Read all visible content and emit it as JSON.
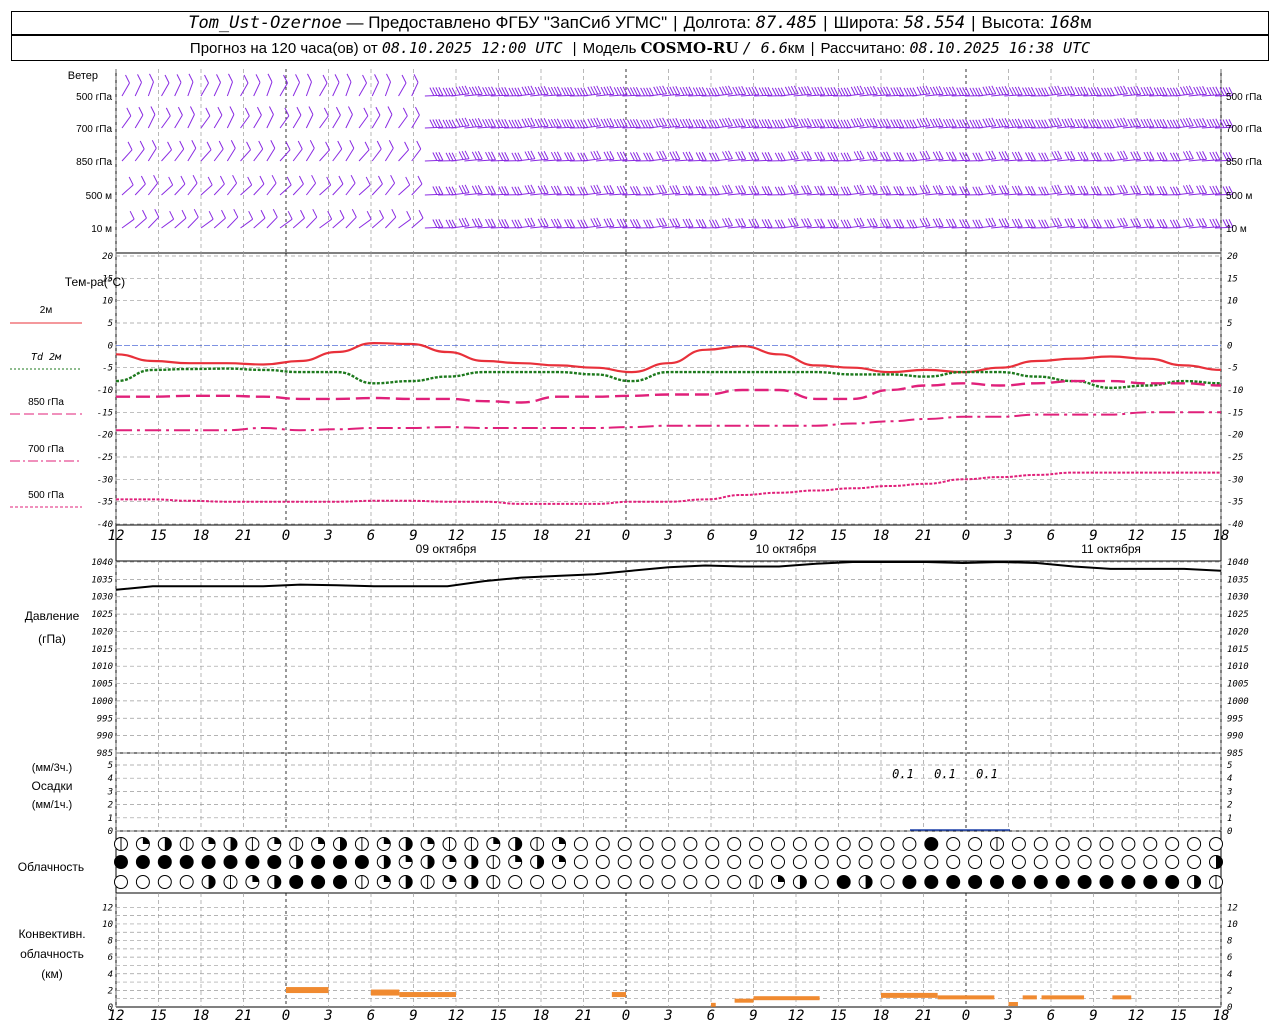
{
  "header": {
    "station": "Tom_Ust-Ozernoe",
    "provider": "— Предоставлено ФГБУ \"ЗапСиб УГМС\"",
    "lon_label": "Долгота:",
    "lon_value": "87.485",
    "lat_label": "Широта:",
    "lat_value": "58.554",
    "alt_label": "Высота:",
    "alt_value": "168",
    "alt_unit": "м",
    "forecast_prefix": "Прогноз на 120 часа(ов) от",
    "forecast_time": "08.10.2025 12:00 UTC",
    "model_label": "Модель",
    "model_name": "COSMO-RU",
    "model_res": "/ 6.6",
    "model_res_unit": "км",
    "calc_label": "Рассчитано:",
    "calc_time": "08.10.2025 16:38 UTC"
  },
  "colors": {
    "wind": "#8a2be2",
    "t2m": "#e8303a",
    "td2m": "#1e7a1e",
    "t850": "#e0207a",
    "t700": "#e0207a",
    "t500": "#e0207a",
    "pressure": "#000000",
    "precip": "#1a3fa8",
    "convective": "#f08a30",
    "grid": "#9a9a9a",
    "zero_line": "#3050d0"
  },
  "time_axis": {
    "hour_labels": [
      "12",
      "15",
      "18",
      "21",
      "0",
      "3",
      "6",
      "9",
      "12",
      "15",
      "18",
      "21",
      "0",
      "3",
      "6",
      "9",
      "12",
      "15",
      "18",
      "21",
      "0",
      "3",
      "6",
      "9",
      "12",
      "15",
      "18"
    ],
    "day_labels": [
      "09 октября",
      "10 октября",
      "11 октября"
    ]
  },
  "wind_panel": {
    "title": "Ветер",
    "levels": [
      "500 гПа",
      "700 гПа",
      "850 гПа",
      "500 м",
      "10 м"
    ]
  },
  "temp_panel": {
    "title": "Тем-ра(°С)",
    "legend": [
      {
        "label": "2м",
        "prefix": "",
        "style": "solid",
        "key": "t2m"
      },
      {
        "label": "2м",
        "prefix": "Td",
        "style": "dot",
        "key": "td2m"
      },
      {
        "label": "850 гПа",
        "prefix": "",
        "style": "dash",
        "key": "t850"
      },
      {
        "label": "700 гПа",
        "prefix": "",
        "style": "dashdot",
        "key": "t700"
      },
      {
        "label": "500 гПа",
        "prefix": "",
        "style": "shortdash",
        "key": "t500"
      }
    ],
    "y_ticks": [
      "20",
      "15",
      "10",
      "5",
      "0",
      "-5",
      "-10",
      "-15",
      "-20",
      "-25",
      "-30",
      "-35",
      "-40"
    ]
  },
  "pressure_panel": {
    "title1": "Давление",
    "title2": "(гПа)",
    "y_ticks": [
      "1040",
      "1035",
      "1030",
      "1025",
      "1020",
      "1015",
      "1010",
      "1005",
      "1000",
      "995",
      "990",
      "985"
    ]
  },
  "precip_panel": {
    "title1": "(мм/3ч.)",
    "title2": "Осадки",
    "title3": "(мм/1ч.)",
    "y_ticks": [
      "5",
      "4",
      "3",
      "2",
      "1",
      "0"
    ],
    "annotations": [
      "0.1",
      "0.1",
      "0.1"
    ]
  },
  "cloud_panel": {
    "title": "Облачность"
  },
  "conv_panel": {
    "title1": "Конвективн.",
    "title2": "облачность",
    "title3": "(км)",
    "y_ticks": [
      "12",
      "10",
      "8",
      "6",
      "4",
      "2",
      "0"
    ]
  },
  "chart_data": [
    {
      "type": "line",
      "title": "Тем-ра(°С)",
      "x": [
        0,
        3,
        6,
        9,
        12,
        15,
        18,
        21,
        24,
        27,
        30,
        33,
        36,
        39,
        42,
        45,
        48,
        51,
        54,
        57,
        60,
        63,
        66,
        69,
        72,
        75,
        78
      ],
      "ylim": [
        -40,
        20
      ],
      "series": [
        {
          "name": "2м",
          "values": [
            -2,
            -3.5,
            -4,
            -4,
            -4.3,
            -3.5,
            -1.5,
            0.5,
            0.3,
            -1.5,
            -3.5,
            -4,
            -4.5,
            -5,
            -6,
            -4,
            -1,
            -0.2,
            -2,
            -4.5,
            -5,
            -6,
            -5.5,
            -6,
            -5,
            -3.5,
            -3,
            -2.5,
            -3,
            -4.5,
            -5.5
          ]
        },
        {
          "name": "Td 2м",
          "values": [
            -8,
            -5.5,
            -5.3,
            -5.2,
            -5.5,
            -6,
            -6,
            -8.5,
            -8,
            -7,
            -6,
            -6,
            -6,
            -6.5,
            -8,
            -6,
            -6,
            -6,
            -6,
            -6,
            -6.5,
            -6.5,
            -7,
            -6,
            -6,
            -7,
            -8,
            -9.5,
            -9,
            -8,
            -8.5
          ]
        },
        {
          "name": "850 гПа",
          "values": [
            -11.5,
            -11.5,
            -11.3,
            -11.3,
            -11.5,
            -12,
            -12,
            -11.8,
            -12,
            -12,
            -12.5,
            -12.8,
            -11.5,
            -11.5,
            -11.3,
            -11,
            -11,
            -10,
            -10,
            -12,
            -12,
            -10,
            -9,
            -8.5,
            -9,
            -8.5,
            -8,
            -8,
            -8.5,
            -8.5,
            -9
          ]
        },
        {
          "name": "700 гПа",
          "values": [
            -19,
            -19,
            -19,
            -19,
            -18.5,
            -19,
            -18.8,
            -18.5,
            -18.5,
            -18.3,
            -18.5,
            -18.5,
            -18.5,
            -18.5,
            -18.3,
            -18,
            -18,
            -18,
            -18,
            -18,
            -17.5,
            -17,
            -16.5,
            -16,
            -16,
            -15.5,
            -15.5,
            -15.5,
            -15,
            -15,
            -15
          ]
        },
        {
          "name": "500 гПа",
          "values": [
            -34.5,
            -34.5,
            -34.8,
            -35,
            -35,
            -35,
            -35,
            -34.8,
            -34.8,
            -35,
            -35,
            -35.5,
            -35.5,
            -35.5,
            -35,
            -35,
            -34.5,
            -33.5,
            -33,
            -32.5,
            -32,
            -31.5,
            -31,
            -30,
            -29.5,
            -29,
            -28.5,
            -28.5,
            -28.5,
            -28.5,
            -28.5
          ]
        }
      ]
    },
    {
      "type": "line",
      "title": "Давление",
      "ylim": [
        985,
        1040
      ],
      "series": [
        {
          "name": "",
          "values": [
            1032,
            1033,
            1033,
            1033,
            1033,
            1033.5,
            1033.3,
            1033,
            1033,
            1033,
            1034.5,
            1035.5,
            1036,
            1036.5,
            1037.5,
            1038.5,
            1039,
            1038.7,
            1038.7,
            1039.5,
            1040,
            1040,
            1040,
            1039.7,
            1040,
            1039.7,
            1038.7,
            1038,
            1038,
            1038,
            1037.5
          ]
        }
      ]
    },
    {
      "type": "bar",
      "title": "Осадки",
      "ylim": [
        0,
        5
      ],
      "values_mm_3h": [
        0.1,
        0.1,
        0.1
      ]
    },
    {
      "type": "bar",
      "title": "Конвективн. облачность",
      "ylim": [
        0,
        13
      ],
      "segments_km": [
        {
          "start_h": 36,
          "end_h": 45,
          "top": 2.4
        },
        {
          "start_h": 54,
          "end_h": 60,
          "top": 2.1
        },
        {
          "start_h": 60,
          "end_h": 72,
          "top": 1.8
        },
        {
          "start_h": 105,
          "end_h": 108,
          "top": 1.8
        },
        {
          "start_h": 126,
          "end_h": 127,
          "top": 0.5
        },
        {
          "start_h": 131,
          "end_h": 135,
          "top": 1.0
        },
        {
          "start_h": 135,
          "end_h": 149,
          "top": 1.3
        },
        {
          "start_h": 162,
          "end_h": 174,
          "top": 1.7
        },
        {
          "start_h": 174,
          "end_h": 186,
          "top": 1.4
        },
        {
          "start_h": 189,
          "end_h": 191,
          "top": 0.6
        },
        {
          "start_h": 192,
          "end_h": 195,
          "top": 1.4
        },
        {
          "start_h": 196,
          "end_h": 205,
          "top": 1.4
        },
        {
          "start_h": 211,
          "end_h": 215,
          "top": 1.4
        }
      ]
    }
  ]
}
